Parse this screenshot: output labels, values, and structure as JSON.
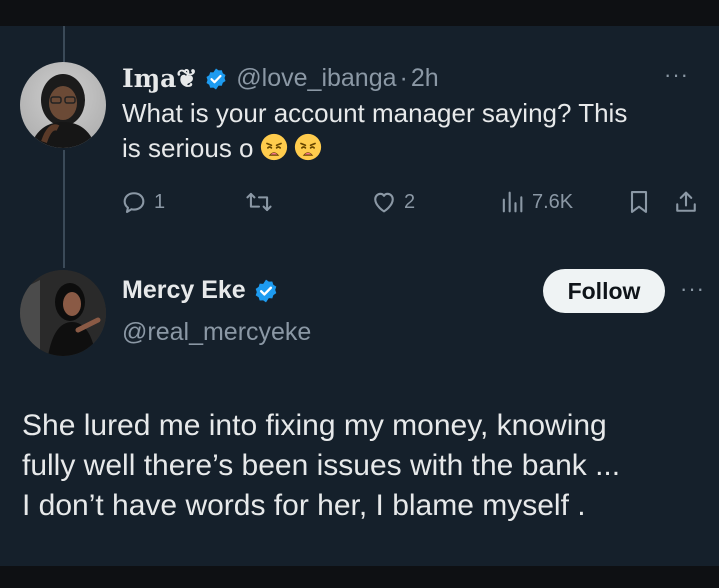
{
  "reply_tweet": {
    "author_name": "Iɱa❦",
    "handle": "@love_ibanga",
    "separator": "·",
    "time": "2h",
    "more_label": "···",
    "text_line_1": "What is your account manager saying? This",
    "text_line_2": "is serious o",
    "emojis": [
      "weary-face-icon",
      "weary-face-icon"
    ],
    "actions": {
      "replies": "1",
      "retweets": "",
      "likes": "2",
      "views": "7.6K"
    }
  },
  "main_tweet": {
    "author_name": "Mercy Eke",
    "handle": "@real_mercyeke",
    "follow_label": "Follow",
    "more_label": "···",
    "text_lines": [
      "She lured me into fixing my money, knowing",
      "fully well there’s been issues with the bank ...",
      "I don’t have words for her, I blame myself ."
    ]
  },
  "colors": {
    "background": "#15202b",
    "text_primary": "#e7e9ea",
    "text_secondary": "#8b98a5",
    "verified_blue": "#1d9bf0",
    "follow_button_bg": "#eff3f4"
  }
}
